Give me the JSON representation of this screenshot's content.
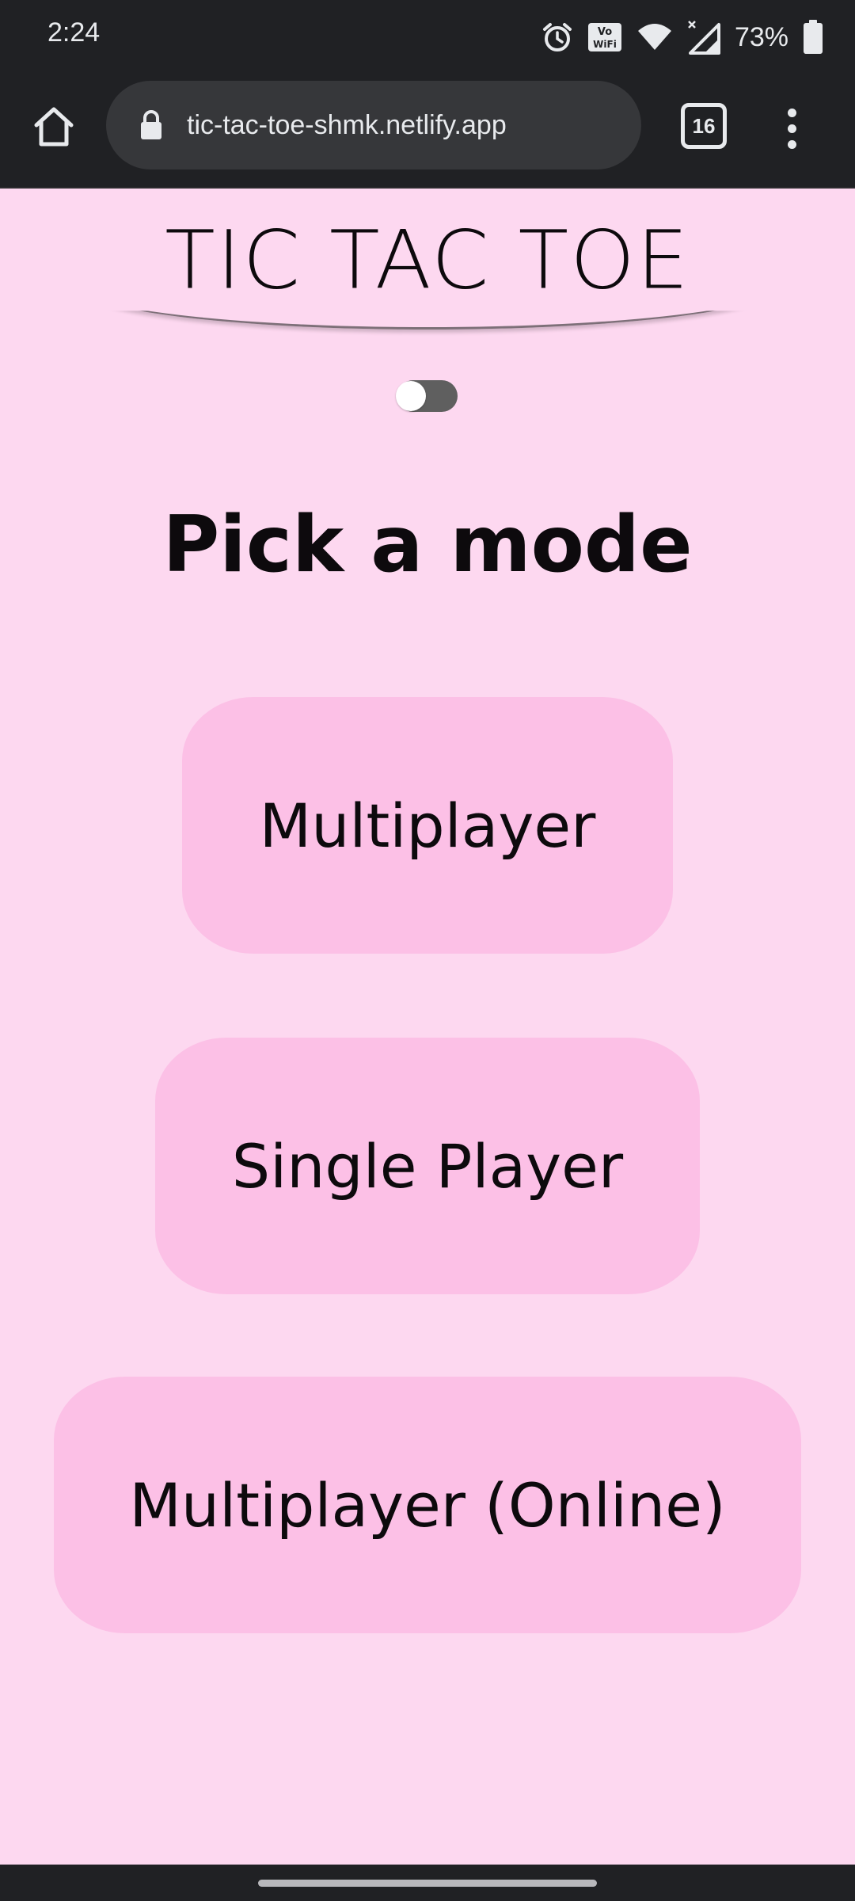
{
  "status_bar": {
    "time": "2:24",
    "battery_percent": "73%",
    "icons": [
      "alarm-icon",
      "vowifi-icon",
      "wifi-icon",
      "cell-signal-icon",
      "battery-icon"
    ]
  },
  "browser": {
    "url": "tic-tac-toe-shmk.netlify.app",
    "tab_count": "16",
    "icons": [
      "home-icon",
      "lock-icon",
      "tabs-icon",
      "overflow-menu-icon"
    ]
  },
  "page": {
    "title": "TIC TAC TOE",
    "theme_toggle": {
      "state": "off"
    },
    "heading": "Pick a mode",
    "modes": [
      {
        "label": "Multiplayer"
      },
      {
        "label": "Single Player"
      },
      {
        "label": "Multiplayer (Online)"
      }
    ]
  },
  "colors": {
    "page_background": "#fdd8f0",
    "button_background": "#fcc0e6",
    "browser_chrome": "#202124",
    "omnibox": "#36373a",
    "text": "#0d0a0d",
    "toggle_track": "#5f5f5f"
  }
}
